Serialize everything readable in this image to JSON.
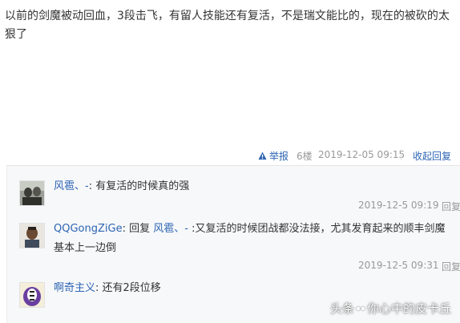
{
  "post": {
    "text": "以前的剑魔被动回血，3段击飞，有留人技能还有复活，不是瑞文能比的，现在的被砍的太狠了",
    "report_label": "举报",
    "floor": "6楼",
    "time": "2019-12-05 09:15",
    "collapse_label": "收起回复"
  },
  "replies": [
    {
      "user": "风雹、-",
      "text": ": 有复活的时候真的强",
      "time": "2019-12-5 09:19",
      "reply_label": "回复"
    },
    {
      "user": "QQGongZiGe",
      "prefix": ": 回复 ",
      "target": "风雹、-",
      "text": " :又复活的时候团战都没法接，尤其发育起来的顺丰剑魔基本上一边倒",
      "time": "2019-12-5 09:31",
      "reply_label": "回复"
    },
    {
      "user": "啊奇主义",
      "text": ": 还有2段位移"
    }
  ],
  "watermark": {
    "prefix": "头条",
    "suffix": "你心中的皮卡丘"
  },
  "colors": {
    "link": "#2d64b3",
    "meta": "#999999",
    "reply_bg": "#f7f8fa"
  }
}
